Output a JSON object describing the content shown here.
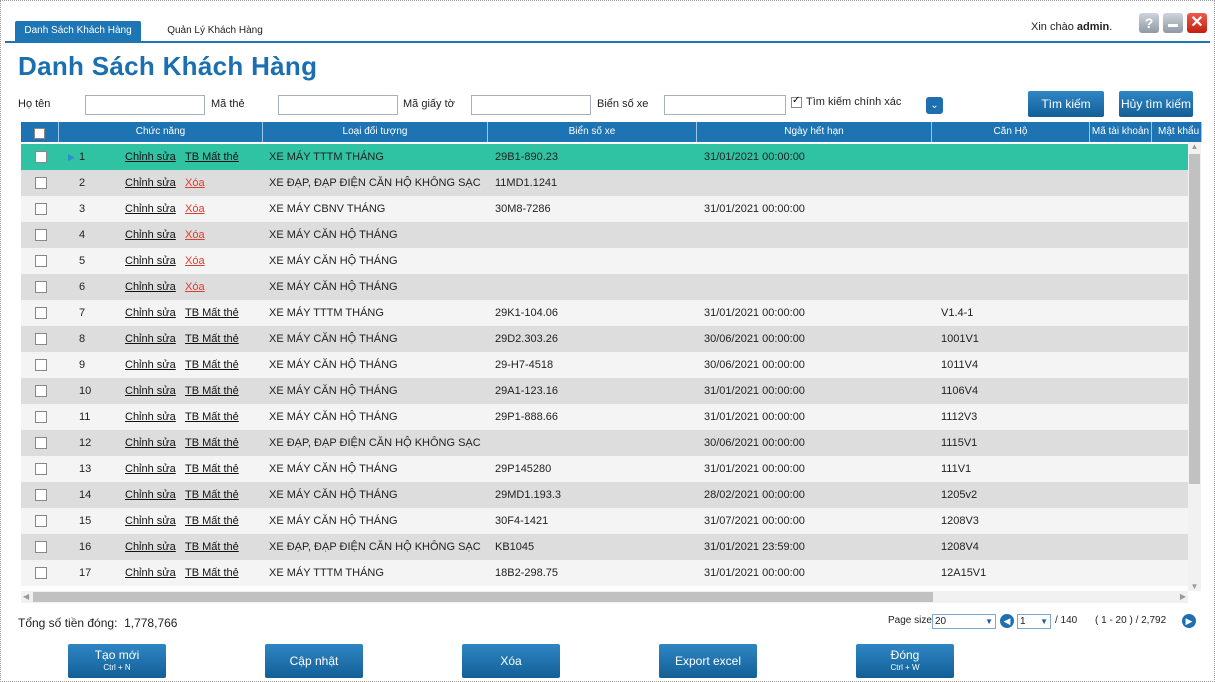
{
  "tabs": [
    {
      "label": "Danh Sách Khách Hàng",
      "active": true
    },
    {
      "label": "Quản Lý Khách Hàng",
      "active": false
    }
  ],
  "greeting": {
    "text": "Xin chào",
    "user": "admin",
    "suffix": "."
  },
  "page_title": "Danh Sách Khách Hàng",
  "search": {
    "name_label": "Họ tên",
    "card_label": "Mã thẻ",
    "doc_label": "Mã giấy tờ",
    "plate_label": "Biển số xe",
    "exact_label": "Tìm kiếm chính xác",
    "search_button": "Tìm kiếm",
    "cancel_button": "Hủy tìm kiếm"
  },
  "grid": {
    "columns": [
      "Chức năng",
      "Loại đối tượng",
      "Biển số xe",
      "Ngày hết hạn",
      "Căn Hộ",
      "Mã tài khoản",
      "Mật khẩu"
    ],
    "rows": [
      {
        "no": "1",
        "edit": "Chỉnh sửa",
        "action": "TB Mất thẻ",
        "type": "XE MÁY TTTM THÁNG",
        "plate": "29B1-890.23",
        "expiry": "31/01/2021 00:00:00",
        "apartment": ""
      },
      {
        "no": "2",
        "edit": "Chỉnh sửa",
        "action": "Xóa",
        "type": "XE ĐẠP, ĐẠP ĐIỆN CĂN HỘ KHÔNG SẠC",
        "plate": "11MD1.1241",
        "expiry": "",
        "apartment": ""
      },
      {
        "no": "3",
        "edit": "Chỉnh sửa",
        "action": "Xóa",
        "type": "XE MÁY CBNV THÁNG",
        "plate": "30M8-7286",
        "expiry": "31/01/2021 00:00:00",
        "apartment": ""
      },
      {
        "no": "4",
        "edit": "Chỉnh sửa",
        "action": "Xóa",
        "type": "XE MÁY CĂN HỘ THÁNG",
        "plate": "",
        "expiry": "",
        "apartment": ""
      },
      {
        "no": "5",
        "edit": "Chỉnh sửa",
        "action": "Xóa",
        "type": "XE MÁY CĂN HỘ THÁNG",
        "plate": "",
        "expiry": "",
        "apartment": ""
      },
      {
        "no": "6",
        "edit": "Chỉnh sửa",
        "action": "Xóa",
        "type": "XE MÁY CĂN HỘ THÁNG",
        "plate": "",
        "expiry": "",
        "apartment": ""
      },
      {
        "no": "7",
        "edit": "Chỉnh sửa",
        "action": "TB Mất thẻ",
        "type": "XE MÁY TTTM THÁNG",
        "plate": "29K1-104.06",
        "expiry": "31/01/2021 00:00:00",
        "apartment": "V1.4-1"
      },
      {
        "no": "8",
        "edit": "Chỉnh sửa",
        "action": "TB Mất thẻ",
        "type": "XE MÁY CĂN HỘ THÁNG",
        "plate": "29D2.303.26",
        "expiry": "30/06/2021 00:00:00",
        "apartment": "1001V1"
      },
      {
        "no": "9",
        "edit": "Chỉnh sửa",
        "action": "TB Mất thẻ",
        "type": "XE MÁY CĂN HỘ THÁNG",
        "plate": "29-H7-4518",
        "expiry": "30/06/2021 00:00:00",
        "apartment": "1011V4"
      },
      {
        "no": "10",
        "edit": "Chỉnh sửa",
        "action": "TB Mất thẻ",
        "type": "XE MÁY CĂN HỘ THÁNG",
        "plate": "29A1-123.16",
        "expiry": "31/01/2021 00:00:00",
        "apartment": "1106V4"
      },
      {
        "no": "11",
        "edit": "Chỉnh sửa",
        "action": "TB Mất thẻ",
        "type": "XE MÁY CĂN HỘ THÁNG",
        "plate": "29P1-888.66",
        "expiry": "31/01/2021 00:00:00",
        "apartment": "1112V3"
      },
      {
        "no": "12",
        "edit": "Chỉnh sửa",
        "action": "TB Mất thẻ",
        "type": "XE ĐẠP, ĐẠP ĐIỆN CĂN HỘ KHÔNG SẠC",
        "plate": "",
        "expiry": "30/06/2021 00:00:00",
        "apartment": "1115V1"
      },
      {
        "no": "13",
        "edit": "Chỉnh sửa",
        "action": "TB Mất thẻ",
        "type": "XE MÁY CĂN HỘ THÁNG",
        "plate": "29P145280",
        "expiry": "31/01/2021 00:00:00",
        "apartment": "111V1"
      },
      {
        "no": "14",
        "edit": "Chỉnh sửa",
        "action": "TB Mất thẻ",
        "type": "XE MÁY CĂN HỘ THÁNG",
        "plate": "29MD1.193.3",
        "expiry": "28/02/2021 00:00:00",
        "apartment": "1205v2"
      },
      {
        "no": "15",
        "edit": "Chỉnh sửa",
        "action": "TB Mất thẻ",
        "type": "XE MÁY CĂN HỘ THÁNG",
        "plate": "30F4-1421",
        "expiry": "31/07/2021 00:00:00",
        "apartment": "1208V3"
      },
      {
        "no": "16",
        "edit": "Chỉnh sửa",
        "action": "TB Mất thẻ",
        "type": "XE ĐẠP, ĐẠP ĐIỆN CĂN HỘ KHÔNG SẠC",
        "plate": "KB1045",
        "expiry": "31/01/2021 23:59:00",
        "apartment": "1208V4"
      },
      {
        "no": "17",
        "edit": "Chỉnh sửa",
        "action": "TB Mất thẻ",
        "type": "XE MÁY TTTM THÁNG",
        "plate": "18B2-298.75",
        "expiry": "31/01/2021 00:00:00",
        "apartment": "12A15V1"
      }
    ]
  },
  "footer": {
    "total_label": "Tổng số tiền đóng:",
    "total_value": "1,778,766",
    "page_size_label": "Page size",
    "page_size": "20",
    "page": "1",
    "page_total": "/ 140",
    "range": "( 1 - 20 ) / 2,792"
  },
  "buttons": {
    "create": {
      "label": "Tạo mới",
      "shortcut": "Ctrl + N"
    },
    "update": {
      "label": "Cập nhật"
    },
    "delete": {
      "label": "Xóa"
    },
    "export": {
      "label": "Export excel"
    },
    "close": {
      "label": "Đóng",
      "shortcut": "Ctrl + W"
    }
  },
  "colors": {
    "accent": "#1e73b3",
    "selected_row": "#2fc3a3",
    "delete_link": "#e23b2f"
  }
}
